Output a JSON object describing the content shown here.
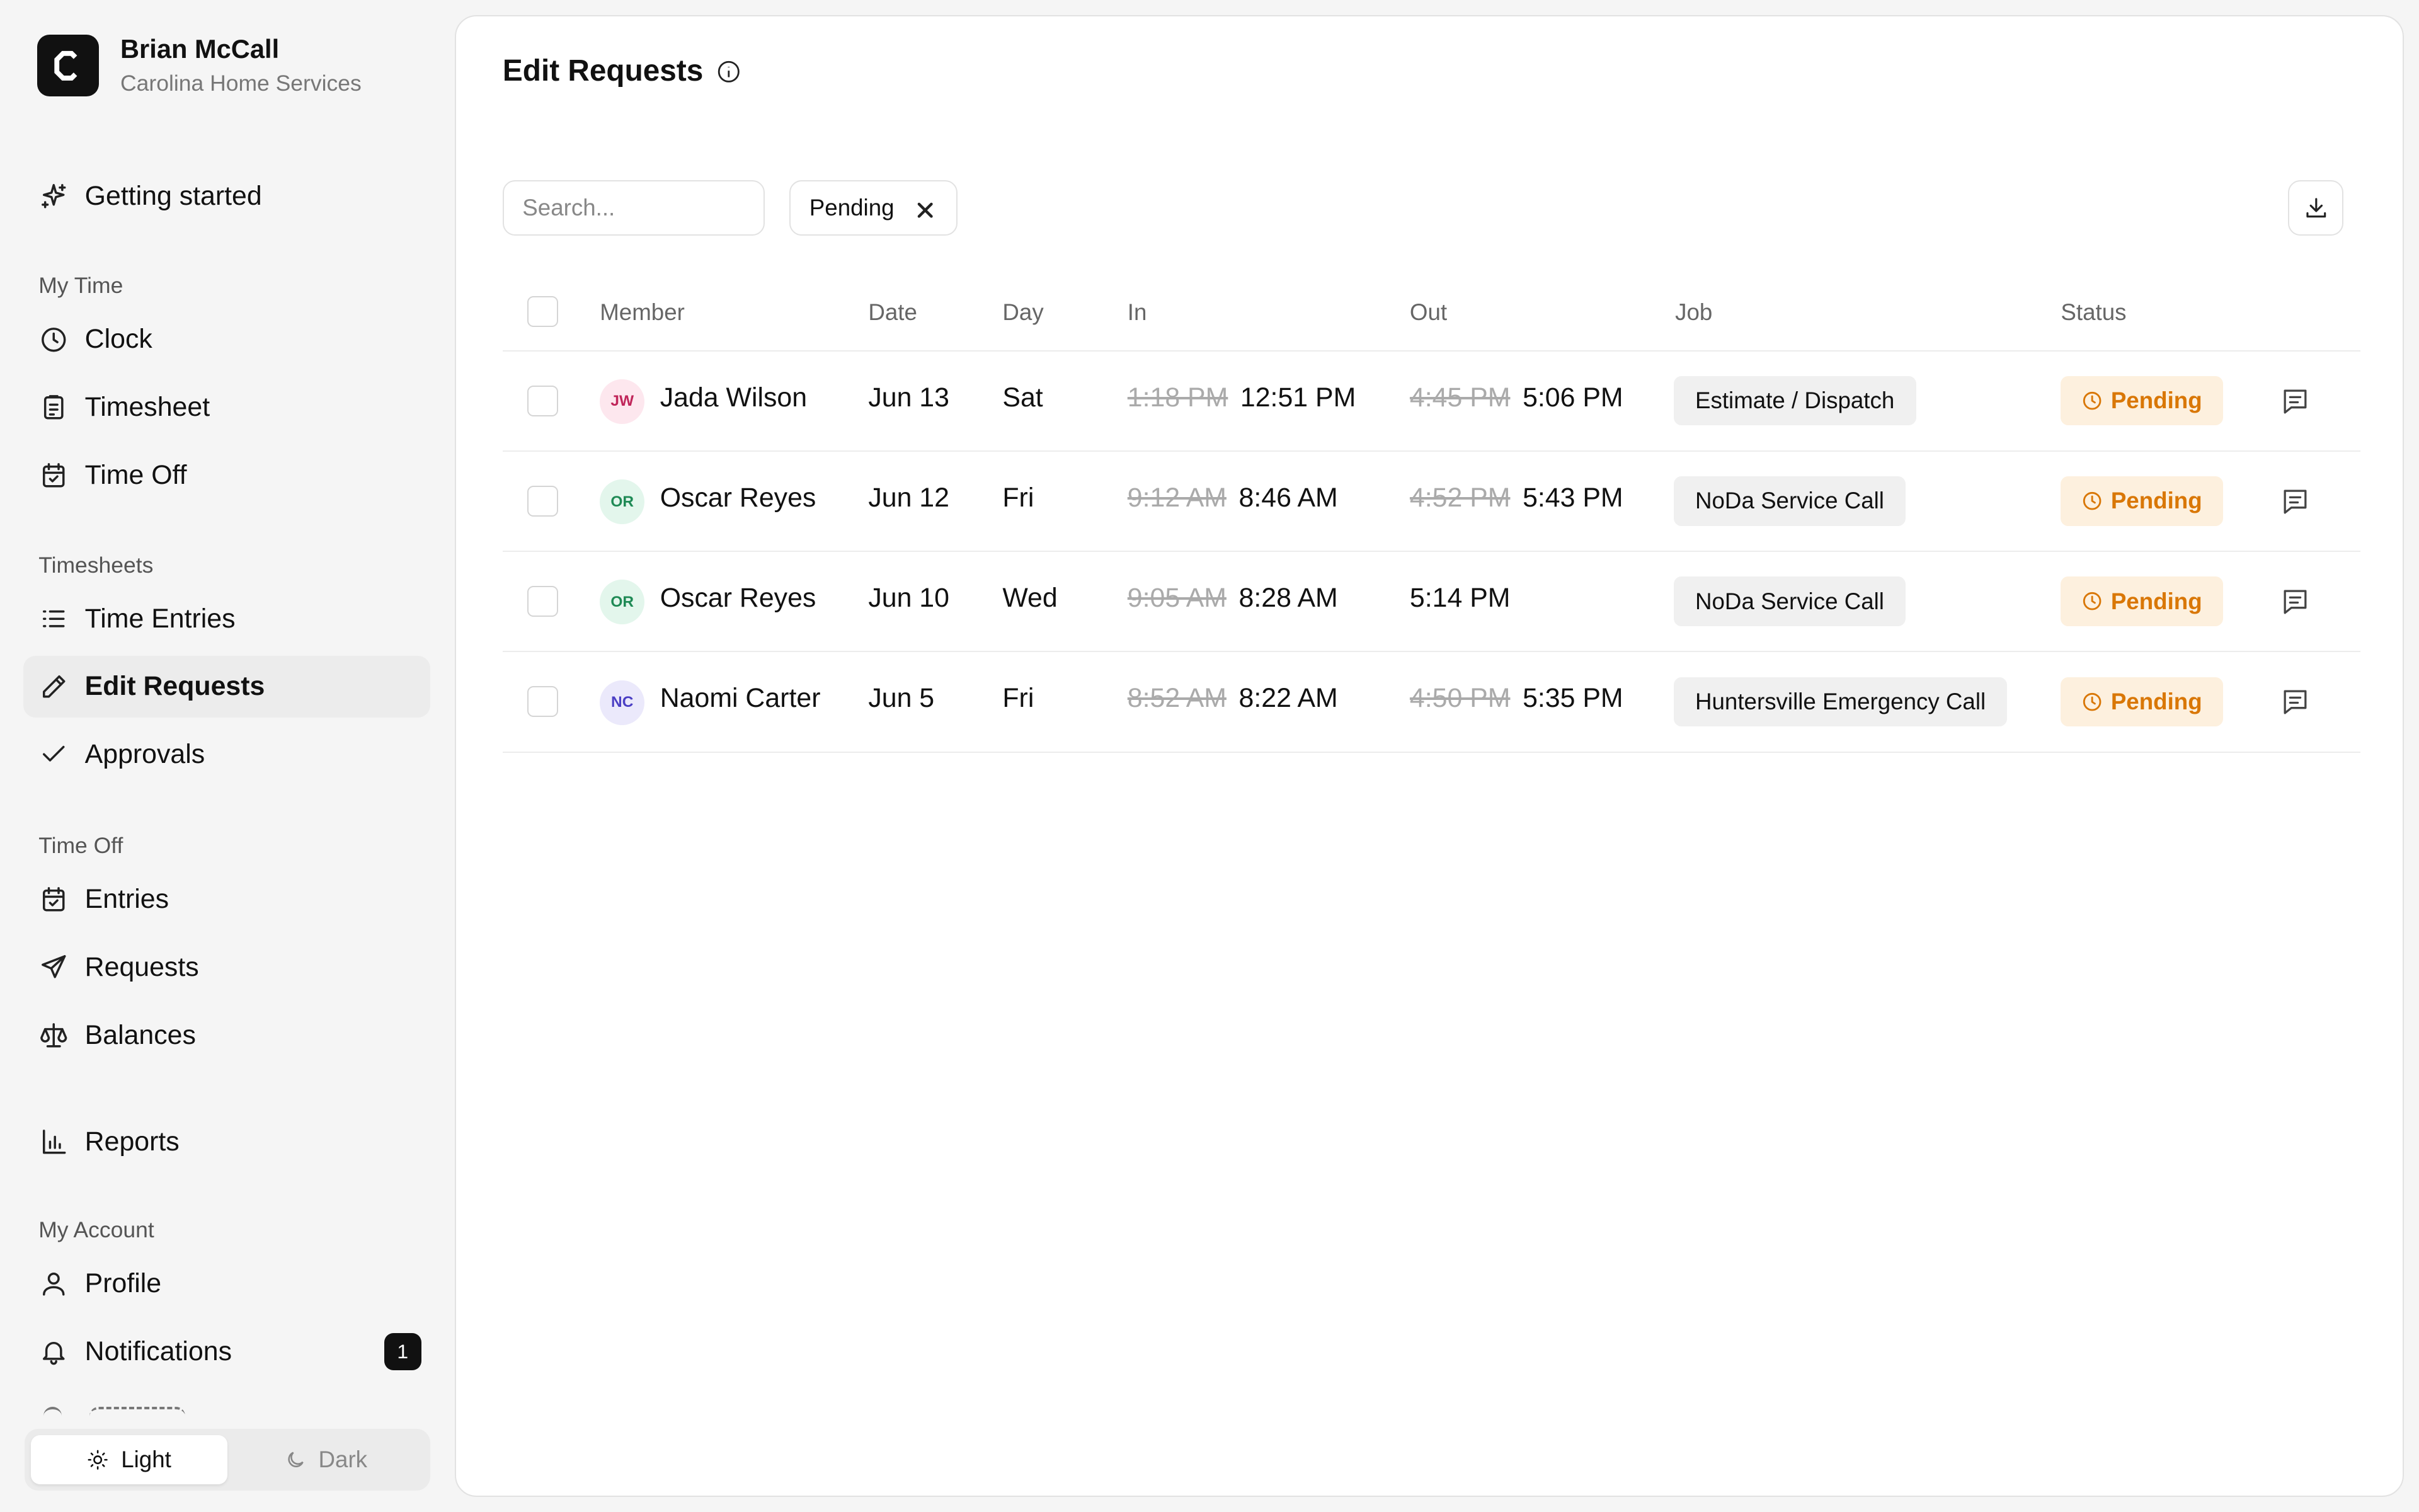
{
  "user": {
    "name": "Brian McCall",
    "organization": "Carolina Home Services",
    "logo_letter": "C"
  },
  "sidebar": {
    "getting_started": "Getting started",
    "sections": {
      "my_time": "My Time",
      "timesheets": "Timesheets",
      "time_off": "Time Off",
      "my_account": "My Account"
    },
    "items": {
      "clock": "Clock",
      "timesheet": "Timesheet",
      "time_off": "Time Off",
      "time_entries": "Time Entries",
      "edit_requests": "Edit Requests",
      "approvals": "Approvals",
      "entries": "Entries",
      "requests": "Requests",
      "balances": "Balances",
      "reports": "Reports",
      "profile": "Profile",
      "notifications": "Notifications"
    },
    "notifications_count": "1",
    "active_item": "edit_requests"
  },
  "theme": {
    "light": "Light",
    "dark": "Dark",
    "selected": "light"
  },
  "page": {
    "title": "Edit Requests"
  },
  "filters": {
    "search_placeholder": "Search...",
    "active_chip": "Pending"
  },
  "table": {
    "headers": {
      "member": "Member",
      "date": "Date",
      "day": "Day",
      "in": "In",
      "out": "Out",
      "job": "Job",
      "status": "Status"
    },
    "rows": [
      {
        "initials": "JW",
        "member": "Jada Wilson",
        "date": "Jun 13",
        "day": "Sat",
        "in_old": "1:18 PM",
        "in_new": "12:51 PM",
        "out_old": "4:45 PM",
        "out_new": "5:06 PM",
        "job": "Estimate / Dispatch",
        "status": "Pending",
        "avatar_bg": "#fde7ee",
        "avatar_fg": "#c0265a"
      },
      {
        "initials": "OR",
        "member": "Oscar Reyes",
        "date": "Jun 12",
        "day": "Fri",
        "in_old": "9:12 AM",
        "in_new": "8:46 AM",
        "out_old": "4:52 PM",
        "out_new": "5:43 PM",
        "job": "NoDa Service Call",
        "status": "Pending",
        "avatar_bg": "#e3f6ec",
        "avatar_fg": "#1f8a55"
      },
      {
        "initials": "OR",
        "member": "Oscar Reyes",
        "date": "Jun 10",
        "day": "Wed",
        "in_old": "9:05 AM",
        "in_new": "8:28 AM",
        "out_old": "",
        "out_new": "5:14 PM",
        "job": "NoDa Service Call",
        "status": "Pending",
        "avatar_bg": "#e3f6ec",
        "avatar_fg": "#1f8a55"
      },
      {
        "initials": "NC",
        "member": "Naomi Carter",
        "date": "Jun 5",
        "day": "Fri",
        "in_old": "8:52 AM",
        "in_new": "8:22 AM",
        "out_old": "4:50 PM",
        "out_new": "5:35 PM",
        "job": "Huntersville Emergency Call",
        "status": "Pending",
        "avatar_bg": "#ebe9fb",
        "avatar_fg": "#4b3fc4"
      }
    ]
  },
  "colors": {
    "accent": "#111111",
    "pending_text": "#d97706",
    "pending_bg": "#fdf0de"
  }
}
